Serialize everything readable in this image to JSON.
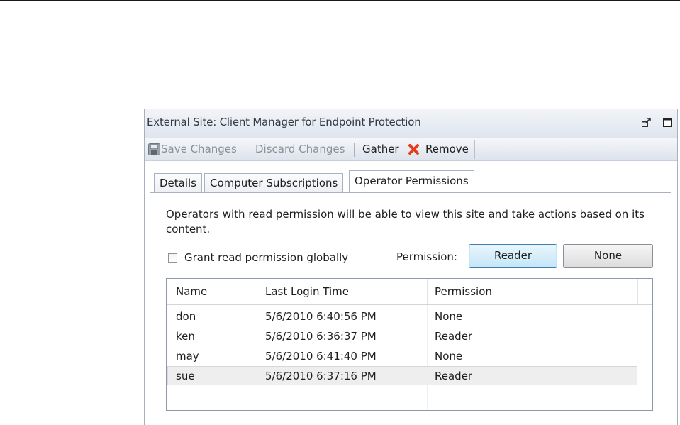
{
  "window": {
    "title": "External Site: Client Manager for Endpoint Protection",
    "undock_icon": "undock-icon",
    "maximize_icon": "maximize-icon"
  },
  "toolbar": {
    "save_label": "Save Changes",
    "discard_label": "Discard Changes",
    "gather_label": "Gather",
    "remove_label": "Remove",
    "save_icon": "floppy-disk-icon",
    "remove_icon": "red-x-icon"
  },
  "tabs": [
    {
      "label": "Details",
      "active": false
    },
    {
      "label": "Computer Subscriptions",
      "active": false
    },
    {
      "label": "Operator Permissions",
      "active": true
    }
  ],
  "permissions": {
    "description": "Operators with read permission will be able to view this site and take actions based on its content.",
    "global_checkbox_label": "Grant read permission globally",
    "global_checked": false,
    "permission_label": "Permission:",
    "reader_button": "Reader",
    "none_button": "None"
  },
  "table": {
    "columns": [
      "Name",
      "Last Login Time",
      "Permission"
    ],
    "rows": [
      {
        "name": "don",
        "last_login": "5/6/2010 6:40:56 PM",
        "permission": "None"
      },
      {
        "name": "ken",
        "last_login": "5/6/2010 6:36:37 PM",
        "permission": "Reader"
      },
      {
        "name": "may",
        "last_login": "5/6/2010 6:41:40 PM",
        "permission": "None"
      },
      {
        "name": "sue",
        "last_login": "5/6/2010 6:37:16 PM",
        "permission": "Reader",
        "selected": true
      }
    ]
  },
  "colors": {
    "remove_icon": "#e63b1f",
    "selected_row": "#eeeeee",
    "focused_button_border": "#3c7fb1"
  }
}
